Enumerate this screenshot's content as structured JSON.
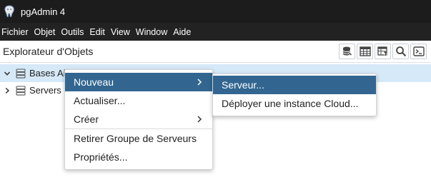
{
  "window": {
    "title": "pgAdmin 4"
  },
  "menubar": {
    "items": [
      "Fichier",
      "Objet",
      "Outils",
      "Edit",
      "View",
      "Window",
      "Aide"
    ]
  },
  "panel": {
    "title": "Explorateur d'Objets",
    "toolbar_icons": [
      "database-query-icon",
      "table-grid-icon",
      "filtered-rows-icon",
      "search-icon",
      "terminal-icon"
    ]
  },
  "tree": {
    "items": [
      {
        "label": "Bases Ai",
        "expanded": true,
        "selected": true
      },
      {
        "label": "Servers",
        "expanded": false,
        "selected": false
      }
    ]
  },
  "context_menu": {
    "items": [
      {
        "label": "Nouveau",
        "submenu": true,
        "active": true
      },
      {
        "label": "Actualiser...",
        "submenu": false
      },
      {
        "label": "Créer",
        "submenu": true
      },
      {
        "label": "Retirer Groupe de Serveurs",
        "submenu": false
      },
      {
        "label": "Propriétés...",
        "submenu": false
      }
    ]
  },
  "submenu": {
    "items": [
      {
        "label": "Serveur...",
        "active": true
      },
      {
        "label": "Déployer une instance Cloud...",
        "active": false
      }
    ]
  },
  "colors": {
    "titlebar_bg": "#1c1c1c",
    "menubar_bg": "#222222",
    "selection_bg": "#d6e9f8",
    "menu_active_bg": "#326690",
    "icon_color": "#444444"
  }
}
